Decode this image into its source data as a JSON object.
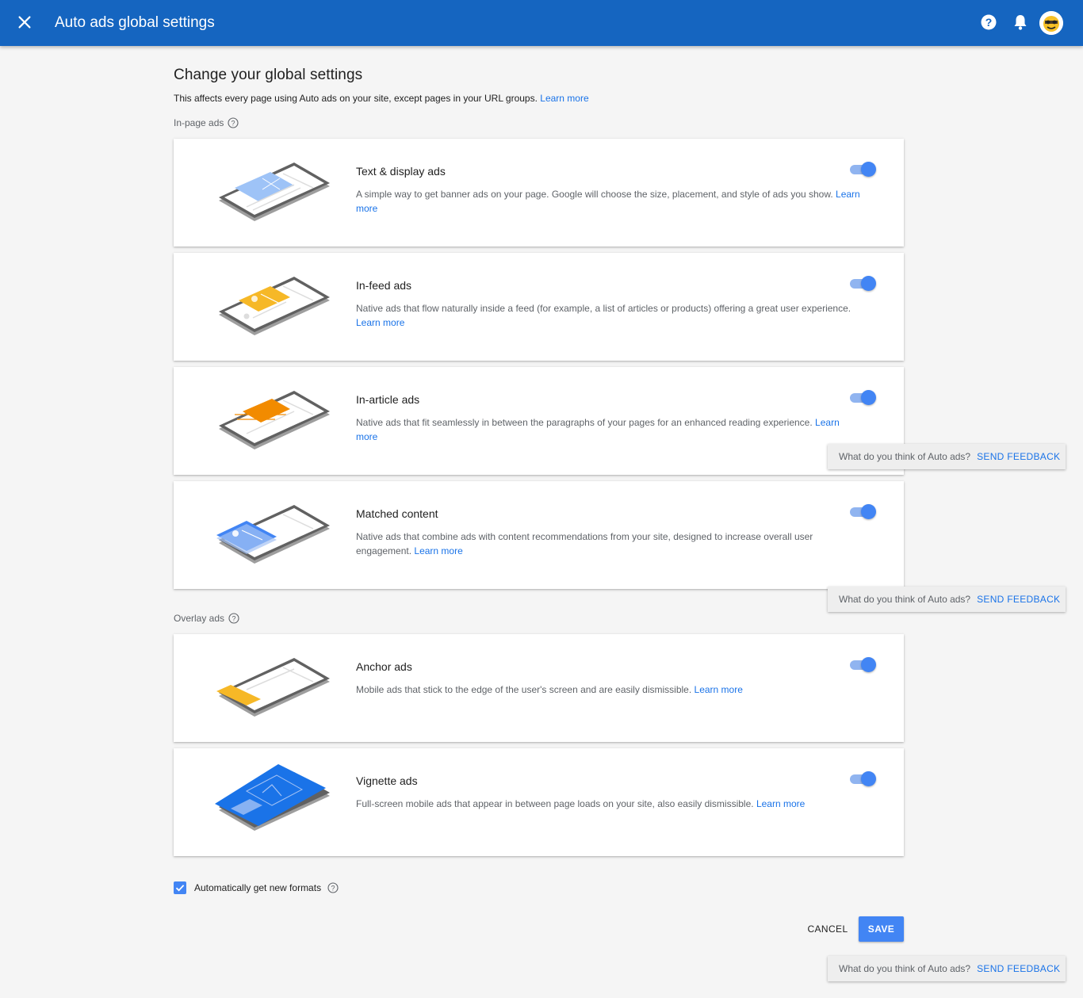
{
  "header": {
    "title": "Auto ads global settings"
  },
  "page": {
    "heading": "Change your global settings",
    "intro": "This affects every page using Auto ads on your site, except pages in your URL groups.",
    "intro_link": "Learn more"
  },
  "sections": {
    "in_page_label": "In-page ads",
    "overlay_label": "Overlay ads"
  },
  "cards": [
    {
      "title": "Text & display ads",
      "desc": "A simple way to get banner ads on your page. Google will choose the size, placement, and style of ads you show.",
      "link": "Learn more",
      "enabled": true
    },
    {
      "title": "In-feed ads",
      "desc": "Native ads that flow naturally inside a feed (for example, a list of articles or products) offering a great user experience.",
      "link": "Learn more",
      "enabled": true
    },
    {
      "title": "In-article ads",
      "desc": "Native ads that fit seamlessly in between the paragraphs of your pages for an enhanced reading experience.",
      "link": "Learn more",
      "enabled": true
    },
    {
      "title": "Matched content",
      "desc": "Native ads that combine ads with content recommendations from your site, designed to increase overall user engagement.",
      "link": "Learn more",
      "enabled": true
    },
    {
      "title": "Anchor ads",
      "desc": "Mobile ads that stick to the edge of the user's screen and are easily dismissible.",
      "link": "Learn more",
      "enabled": true
    },
    {
      "title": "Vignette ads",
      "desc": "Full-screen mobile ads that appear in between page loads on your site, also easily dismissible.",
      "link": "Learn more",
      "enabled": true
    }
  ],
  "auto_formats": {
    "label": "Automatically get new formats",
    "checked": true
  },
  "actions": {
    "cancel": "CANCEL",
    "save": "SAVE"
  },
  "feedback": {
    "question": "What do you think of Auto ads?",
    "button": "SEND FEEDBACK"
  },
  "colors": {
    "header": "#1565c0",
    "accent": "#4285f4",
    "link": "#1a73e8",
    "yellow": "#f6b827",
    "orange": "#f28b00"
  }
}
